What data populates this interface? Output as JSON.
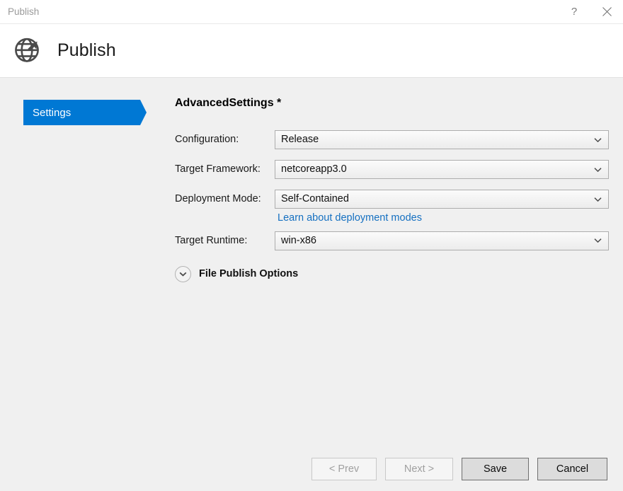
{
  "window": {
    "title": "Publish",
    "help_button": "?",
    "close_button": "✕"
  },
  "header": {
    "icon": "globe-publish-icon",
    "title": "Publish"
  },
  "steps": {
    "items": [
      {
        "label": "Settings",
        "selected": true
      }
    ]
  },
  "main": {
    "section_title": "AdvancedSettings *",
    "fields": [
      {
        "label": "Configuration:",
        "value": "Release",
        "name": "configuration"
      },
      {
        "label": "Target Framework:",
        "value": "netcoreapp3.0",
        "name": "target-framework"
      },
      {
        "label": "Deployment Mode:",
        "value": "Self-Contained",
        "name": "deployment-mode"
      },
      {
        "label": "Target Runtime:",
        "value": "win-x86",
        "name": "target-runtime"
      }
    ],
    "deployment_link": "Learn about deployment modes",
    "expander": {
      "label": "File Publish Options",
      "icon": "chevron-down-icon",
      "expanded": false
    }
  },
  "footer": {
    "buttons": [
      {
        "label": "< Prev",
        "enabled": false
      },
      {
        "label": "Next >",
        "enabled": false
      },
      {
        "label": "Save",
        "enabled": true
      },
      {
        "label": "Cancel",
        "enabled": true
      }
    ]
  },
  "colors": {
    "accent": "#0078d4",
    "link": "#1570c1",
    "body_bg": "#f0f0f0",
    "panel_bg": "#ffffff"
  }
}
